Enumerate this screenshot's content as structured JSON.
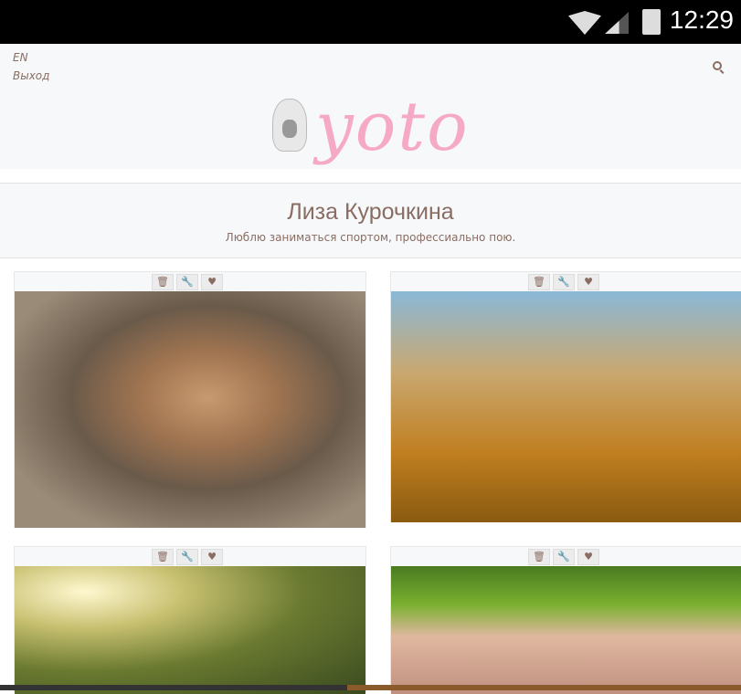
{
  "status_bar": {
    "time": "12:29"
  },
  "header": {
    "lang": "EN",
    "logout": "Выход",
    "logo_text": "yoto"
  },
  "profile": {
    "name": "Лиза Курочкина",
    "bio": "Люблю заниматься спортом, профессиально пою."
  },
  "card_buttons": {
    "delete": "🗑",
    "edit": "🔧",
    "like": "♥"
  },
  "colors": {
    "accent": "#8a6d62",
    "logo": "#f6a9c6",
    "background": "#f7f8fa"
  }
}
